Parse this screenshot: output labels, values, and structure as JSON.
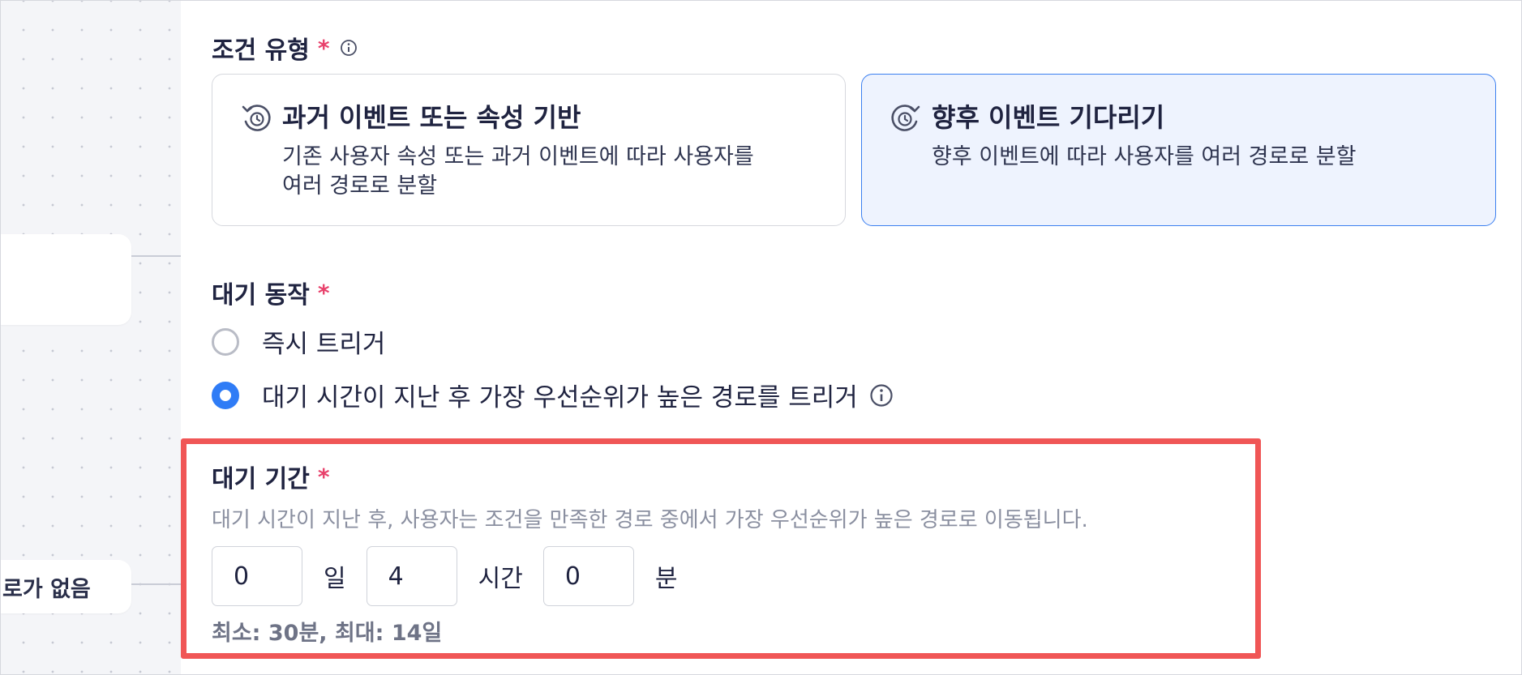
{
  "canvas": {
    "node_b_label": "로가 없음"
  },
  "condition_type": {
    "label": "조건 유형",
    "required_mark": "*",
    "info_icon": "info-icon",
    "options": [
      {
        "title": "과거 이벤트 또는 속성 기반",
        "desc_line1": "기존 사용자 속성 또는 과거 이벤트에 따라 사용자를",
        "desc_line2": "여러 경로로 분할",
        "icon": "history-clock-icon",
        "selected": false
      },
      {
        "title": "향후 이벤트 기다리기",
        "desc_line1": "향후 이벤트에 따라 사용자를 여러 경로로 분할",
        "desc_line2": "",
        "icon": "future-clock-icon",
        "selected": true
      }
    ]
  },
  "wait_action": {
    "label": "대기 동작",
    "required_mark": "*",
    "options": [
      {
        "label": "즉시 트리거",
        "selected": false
      },
      {
        "label": "대기 시간이 지난 후 가장 우선순위가 높은 경로를 트리거",
        "selected": true,
        "info_icon": "info-icon"
      }
    ]
  },
  "wait_duration": {
    "label": "대기 기간",
    "required_mark": "*",
    "helper": "대기 시간이 지난 후, 사용자는 조건을 만족한 경로 중에서 가장 우선순위가 높은 경로로 이동됩니다.",
    "days": {
      "value": "0",
      "unit": "일"
    },
    "hours": {
      "value": "4",
      "unit": "시간"
    },
    "minutes": {
      "value": "0",
      "unit": "분"
    },
    "limits": "최소: 30분, 최대: 14일"
  },
  "colors": {
    "accent": "#2f7cf6",
    "required": "#e8416b",
    "highlight": "#f05656",
    "selected_card_bg": "#eef3fe"
  }
}
